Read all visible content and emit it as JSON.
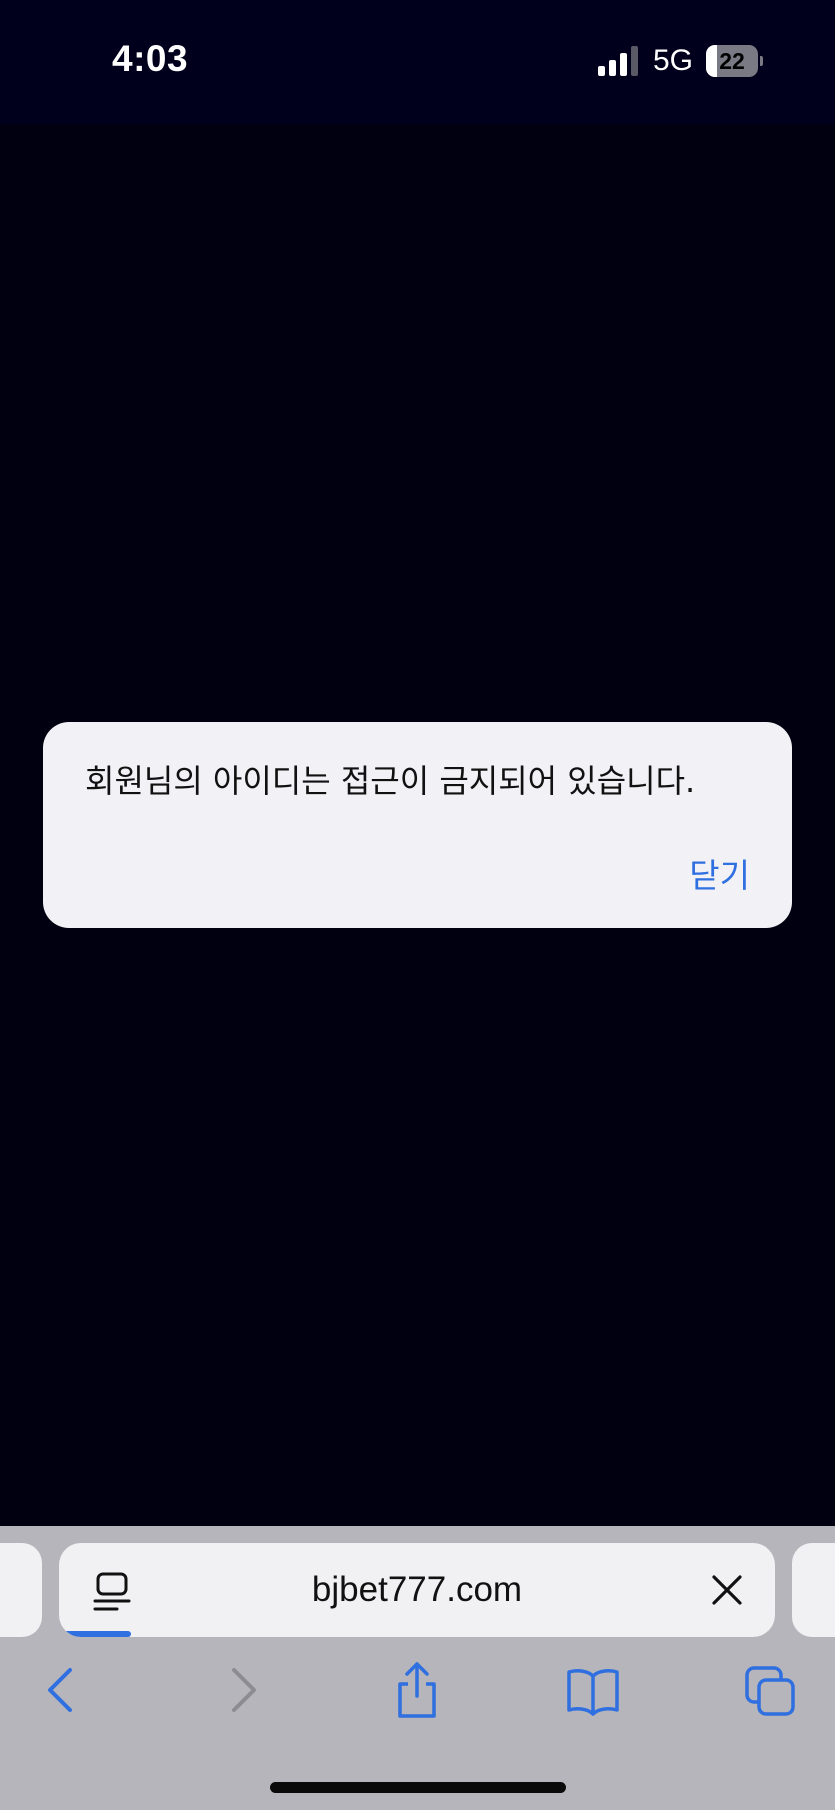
{
  "status_bar": {
    "time": "4:03",
    "network": "5G",
    "battery_level": "22",
    "icons": [
      "signal-icon",
      "battery-icon"
    ]
  },
  "alert": {
    "message": "회원님의 아이디는 접근이 금지되어 있습니다.",
    "close_label": "닫기"
  },
  "browser": {
    "address": "bjbet777.com",
    "load_progress": 0.1,
    "icons": [
      "reader-icon",
      "clear-icon",
      "back-icon",
      "forward-icon",
      "share-icon",
      "bookmarks-icon",
      "tabs-icon"
    ]
  },
  "colors": {
    "background": "#000010",
    "status_bar": "#00001c",
    "accent": "#2f6fe0",
    "alert_bg": "#f1f1f6",
    "toolbar_bg": "#b5b5bb",
    "disabled_icon": "#8c8c92"
  }
}
